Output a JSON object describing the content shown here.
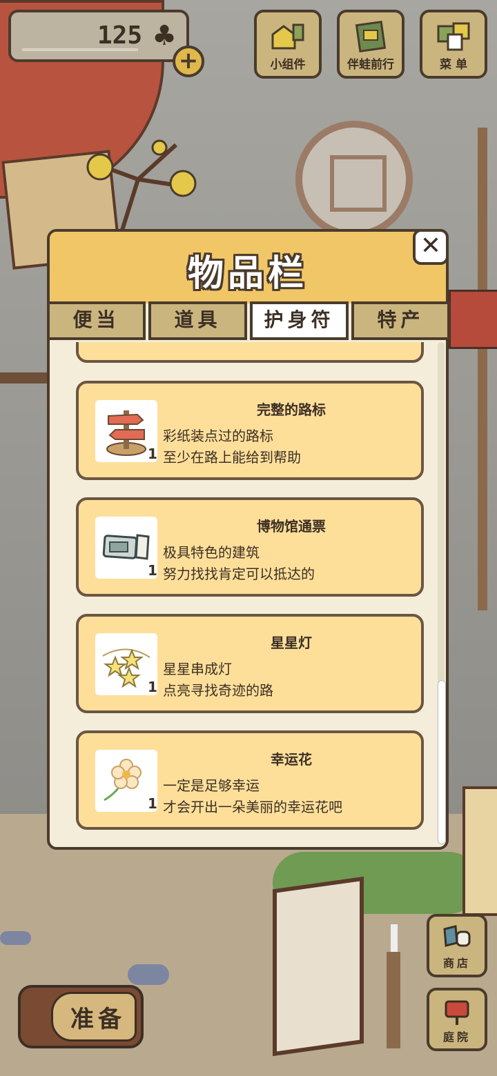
{
  "currency": {
    "count": "125",
    "icon": "clover-icon",
    "add_label": "+"
  },
  "top_buttons": [
    {
      "label": "小组件",
      "icon": "widget-icon"
    },
    {
      "label": "伴蛙前行",
      "icon": "album-icon"
    },
    {
      "label": "菜 单",
      "icon": "menu-icon"
    }
  ],
  "panel": {
    "title": "物品栏",
    "close_label": "✕",
    "tabs": [
      {
        "label": "便当",
        "active": false
      },
      {
        "label": "道具",
        "active": false
      },
      {
        "label": "护身符",
        "active": true
      },
      {
        "label": "特产",
        "active": false
      }
    ],
    "items": [
      {
        "name": "完整的路标",
        "desc1": "彩纸装点过的路标",
        "desc2": "至少在路上能给到帮助",
        "qty": "1",
        "icon": "signpost-icon"
      },
      {
        "name": "博物馆通票",
        "desc1": "极具特色的建筑",
        "desc2": "努力找找肯定可以抵达的",
        "qty": "1",
        "icon": "ticket-icon"
      },
      {
        "name": "星星灯",
        "desc1": "星星串成灯",
        "desc2": "点亮寻找奇迹的路",
        "qty": "1",
        "icon": "star-lamp-icon"
      },
      {
        "name": "幸运花",
        "desc1": "一定是足够幸运",
        "desc2": "才会开出一朵美丽的幸运花吧",
        "qty": "1",
        "icon": "lucky-flower-icon"
      }
    ]
  },
  "bottom": {
    "ready_label": "准备",
    "shop_label": "商店",
    "yard_label": "庭院"
  },
  "colors": {
    "header": "#f1c667",
    "card": "#fedf9a",
    "outline": "#4a3b2c",
    "button": "#cbb57f"
  }
}
